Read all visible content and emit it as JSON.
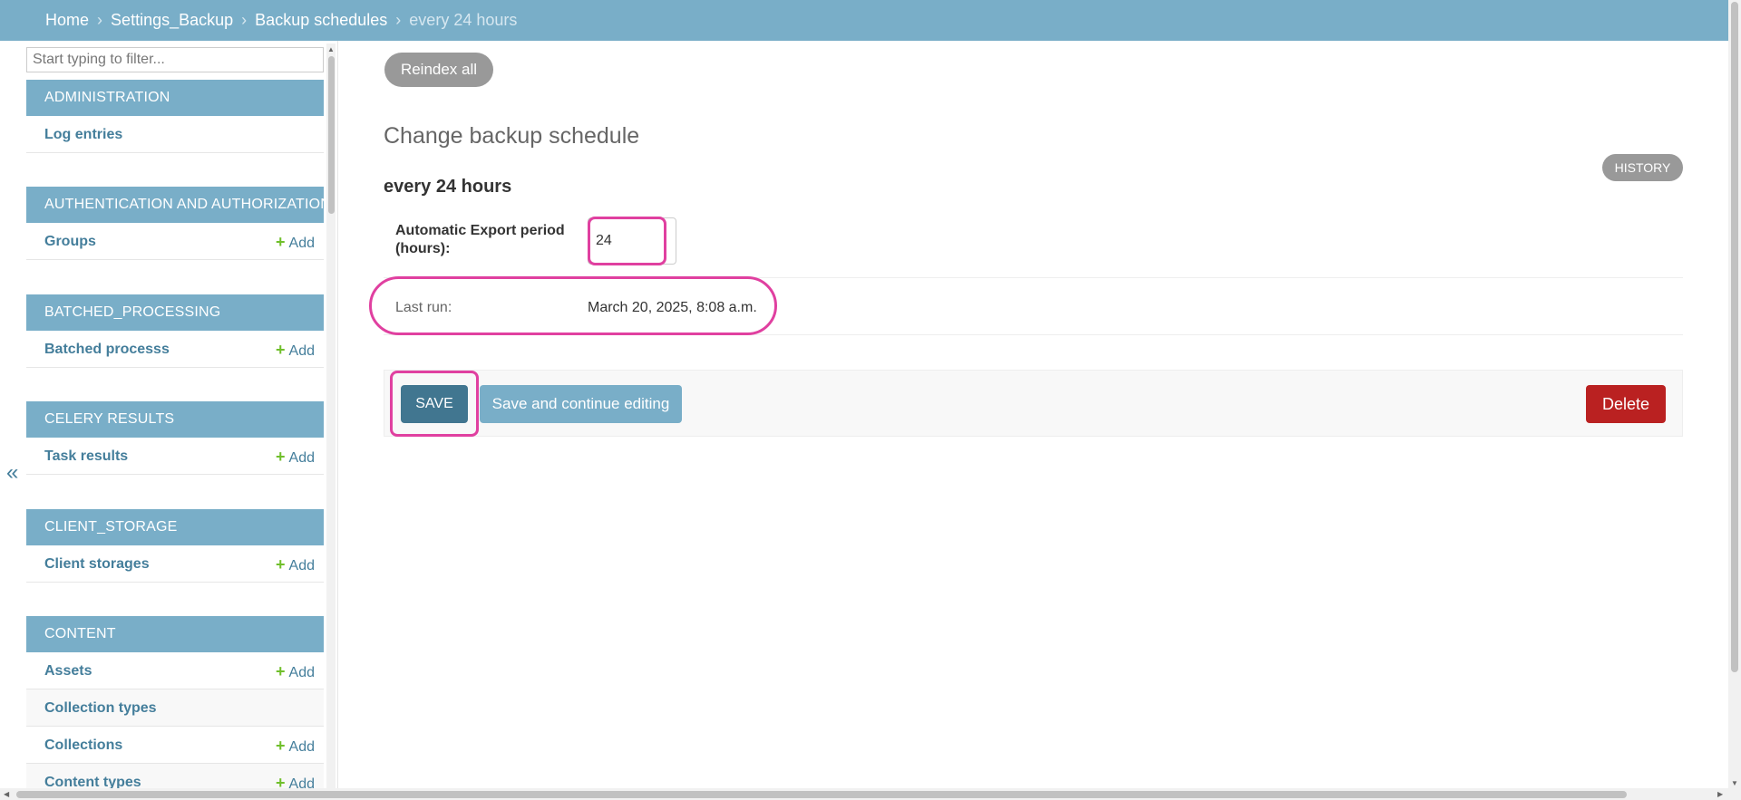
{
  "breadcrumbs": {
    "home": "Home",
    "app": "Settings_Backup",
    "model": "Backup schedules",
    "current": "every 24 hours",
    "separator": "›"
  },
  "sidebar": {
    "filter_placeholder": "Start typing to filter...",
    "add_label": "Add",
    "collapse_label": "«",
    "sections": [
      {
        "header": "Administration",
        "items": [
          {
            "label": "Log entries",
            "add": false
          }
        ]
      },
      {
        "header": "Authentication and Authorization",
        "items": [
          {
            "label": "Groups",
            "add": true
          }
        ]
      },
      {
        "header": "Batched_Processing",
        "items": [
          {
            "label": "Batched processs",
            "add": true
          }
        ]
      },
      {
        "header": "Celery Results",
        "items": [
          {
            "label": "Task results",
            "add": true
          }
        ]
      },
      {
        "header": "Client_Storage",
        "items": [
          {
            "label": "Client storages",
            "add": true
          }
        ]
      },
      {
        "header": "Content",
        "items": [
          {
            "label": "Assets",
            "add": true
          },
          {
            "label": "Collection types",
            "add": false
          },
          {
            "label": "Collections",
            "add": true
          },
          {
            "label": "Content types",
            "add": true
          }
        ]
      }
    ]
  },
  "content": {
    "reindex_label": "Reindex all",
    "page_title": "Change backup schedule",
    "history_label": "History",
    "object_title": "every 24 hours",
    "field_label": "Automatic Export period (hours):",
    "field_value": "24",
    "last_run_label": "Last run:",
    "last_run_value": "March 20, 2025, 8:08 a.m."
  },
  "submit": {
    "save_label": "Save",
    "continue_label": "Save and continue editing",
    "delete_label": "Delete"
  },
  "colors": {
    "header_bg": "#79aec8",
    "link": "#447e9b",
    "save_bg": "#417690",
    "delete_bg": "#ba2121",
    "add_plus": "#70bf2b",
    "annotation": "#e040a0"
  }
}
